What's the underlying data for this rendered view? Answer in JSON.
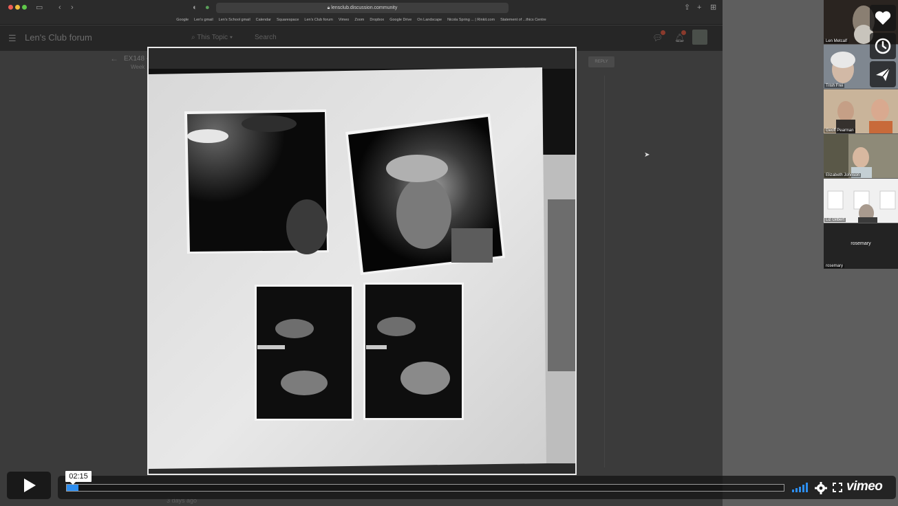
{
  "browser": {
    "url": "lensclub.discussion.community",
    "bookmarks": [
      "Google",
      "Len's gmail",
      "Len's School gmail",
      "Calendar",
      "Squarespace",
      "Len's Club forum",
      "Vimeo",
      "Zoom",
      "Dropbox",
      "Google Drive",
      "On Landscape",
      "Nicola Spring ... | Rinkit.com",
      "Statement of ...thics Centre"
    ]
  },
  "forum": {
    "title": "Len's Club forum",
    "search_scope": "This Topic",
    "search_placeholder": "Search",
    "topic_title": "EX148 -",
    "topic_category": "Week",
    "reply_label": "REPLY",
    "post_age": "3 days ago"
  },
  "participants": [
    {
      "name": "Len Metcalf"
    },
    {
      "name": "Trish Frei"
    },
    {
      "name": "Geoff Pearman"
    },
    {
      "name": "Elizabeth Johnson"
    },
    {
      "name": "Liz Gilbert"
    },
    {
      "name": "rosemary",
      "center_label": "rosemary"
    }
  ],
  "player": {
    "current_time": "02:15",
    "progress": 0.016,
    "logo": "vimeo",
    "side_actions": [
      "heart-icon",
      "clock-icon",
      "send-icon"
    ]
  },
  "colors": {
    "progress": "#2d8ef0",
    "dot_red": "#ee5e56",
    "dot_yellow": "#f1bd3d",
    "dot_green": "#5fc84a"
  }
}
